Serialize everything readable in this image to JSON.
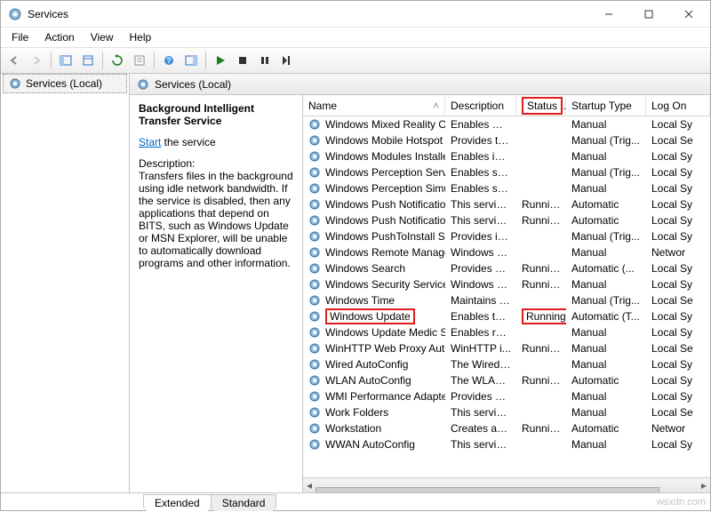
{
  "window": {
    "title": "Services"
  },
  "menu": {
    "file": "File",
    "action": "Action",
    "view": "View",
    "help": "Help"
  },
  "tree": {
    "root": "Services (Local)"
  },
  "mid": {
    "heading": "Services (Local)"
  },
  "detail": {
    "service_name": "Background Intelligent Transfer Service",
    "start_link": "Start",
    "start_suffix": " the service",
    "desc_label": "Description:",
    "desc": "Transfers files in the background using idle network bandwidth. If the service is disabled, then any applications that depend on BITS, such as Windows Update or MSN Explorer, will be unable to automatically download programs and other information."
  },
  "columns": {
    "name": "Name",
    "description": "Description",
    "status": "Status",
    "startup": "Startup Type",
    "logon": "Log On"
  },
  "rows": [
    {
      "name": "Windows Mixed Reality Op...",
      "desc": "Enables Mix...",
      "status": "",
      "startup": "Manual",
      "logon": "Local Sy"
    },
    {
      "name": "Windows Mobile Hotspot S...",
      "desc": "Provides th...",
      "status": "",
      "startup": "Manual (Trig...",
      "logon": "Local Se"
    },
    {
      "name": "Windows Modules Installer",
      "desc": "Enables inst...",
      "status": "",
      "startup": "Manual",
      "logon": "Local Sy"
    },
    {
      "name": "Windows Perception Service",
      "desc": "Enables spa...",
      "status": "",
      "startup": "Manual (Trig...",
      "logon": "Local Sy"
    },
    {
      "name": "Windows Perception Simul...",
      "desc": "Enables spa...",
      "status": "",
      "startup": "Manual",
      "logon": "Local Sy"
    },
    {
      "name": "Windows Push Notificatio...",
      "desc": "This service ...",
      "status": "Running",
      "startup": "Automatic",
      "logon": "Local Sy"
    },
    {
      "name": "Windows Push Notificatio...",
      "desc": "This service ...",
      "status": "Running",
      "startup": "Automatic",
      "logon": "Local Sy"
    },
    {
      "name": "Windows PushToInstall Serv...",
      "desc": "Provides inf...",
      "status": "",
      "startup": "Manual (Trig...",
      "logon": "Local Sy"
    },
    {
      "name": "Windows Remote Manage...",
      "desc": "Windows R...",
      "status": "",
      "startup": "Manual",
      "logon": "Networ"
    },
    {
      "name": "Windows Search",
      "desc": "Provides co...",
      "status": "Running",
      "startup": "Automatic (...",
      "logon": "Local Sy"
    },
    {
      "name": "Windows Security Service",
      "desc": "Windows Se...",
      "status": "Running",
      "startup": "Manual",
      "logon": "Local Sy"
    },
    {
      "name": "Windows Time",
      "desc": "Maintains d...",
      "status": "",
      "startup": "Manual (Trig...",
      "logon": "Local Se"
    },
    {
      "name": "Windows Update",
      "desc": "Enables the ...",
      "status": "Running",
      "startup": "Automatic (T...",
      "logon": "Local Sy",
      "hl": true
    },
    {
      "name": "Windows Update Medic Ser...",
      "desc": "Enables rem...",
      "status": "",
      "startup": "Manual",
      "logon": "Local Sy"
    },
    {
      "name": "WinHTTP Web Proxy Auto-...",
      "desc": "WinHTTP i...",
      "status": "Running",
      "startup": "Manual",
      "logon": "Local Se"
    },
    {
      "name": "Wired AutoConfig",
      "desc": "The Wired A...",
      "status": "",
      "startup": "Manual",
      "logon": "Local Sy"
    },
    {
      "name": "WLAN AutoConfig",
      "desc": "The WLANS...",
      "status": "Running",
      "startup": "Automatic",
      "logon": "Local Sy"
    },
    {
      "name": "WMI Performance Adapter",
      "desc": "Provides pe...",
      "status": "",
      "startup": "Manual",
      "logon": "Local Sy"
    },
    {
      "name": "Work Folders",
      "desc": "This service ...",
      "status": "",
      "startup": "Manual",
      "logon": "Local Se"
    },
    {
      "name": "Workstation",
      "desc": "Creates and...",
      "status": "Running",
      "startup": "Automatic",
      "logon": "Networ"
    },
    {
      "name": "WWAN AutoConfig",
      "desc": "This service ...",
      "status": "",
      "startup": "Manual",
      "logon": "Local Sy"
    }
  ],
  "tabs": {
    "extended": "Extended",
    "standard": "Standard"
  },
  "watermark": "wsxdn.com"
}
